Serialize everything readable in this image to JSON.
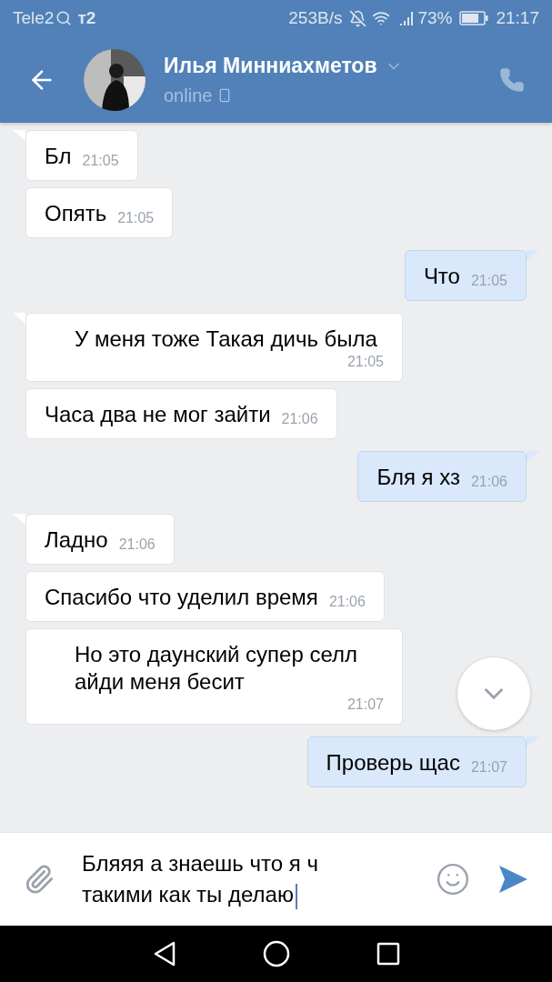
{
  "status_bar": {
    "carrier": "Tele2",
    "carrier_logo": "т2",
    "speed": "253B/s",
    "battery": "73%",
    "time": "21:17"
  },
  "header": {
    "name": "Илья Минниахметов",
    "status": "online"
  },
  "messages": [
    {
      "kind": "incoming",
      "text": "Бл",
      "time": "21:05"
    },
    {
      "kind": "incoming",
      "text": "Опять",
      "time": "21:05"
    },
    {
      "kind": "outgoing",
      "text": "Что",
      "time": "21:05"
    },
    {
      "kind": "incoming",
      "text": "У меня тоже Такая дичь была",
      "time": "21:05"
    },
    {
      "kind": "incoming",
      "text": "Часа два не мог зайти",
      "time": "21:06"
    },
    {
      "kind": "outgoing",
      "text": "Бля я хз",
      "time": "21:06"
    },
    {
      "kind": "incoming",
      "text": "Ладно",
      "time": "21:06"
    },
    {
      "kind": "incoming",
      "text": "Спасибо что уделил время",
      "time": "21:06"
    },
    {
      "kind": "incoming",
      "text": "Но это даунский супер селл айди меня бесит",
      "time": "21:07"
    },
    {
      "kind": "outgoing",
      "text": "Проверь щас",
      "time": "21:07"
    }
  ],
  "composer": {
    "value": "Бляяя а знаешь что я ч такими как ты делаю"
  }
}
